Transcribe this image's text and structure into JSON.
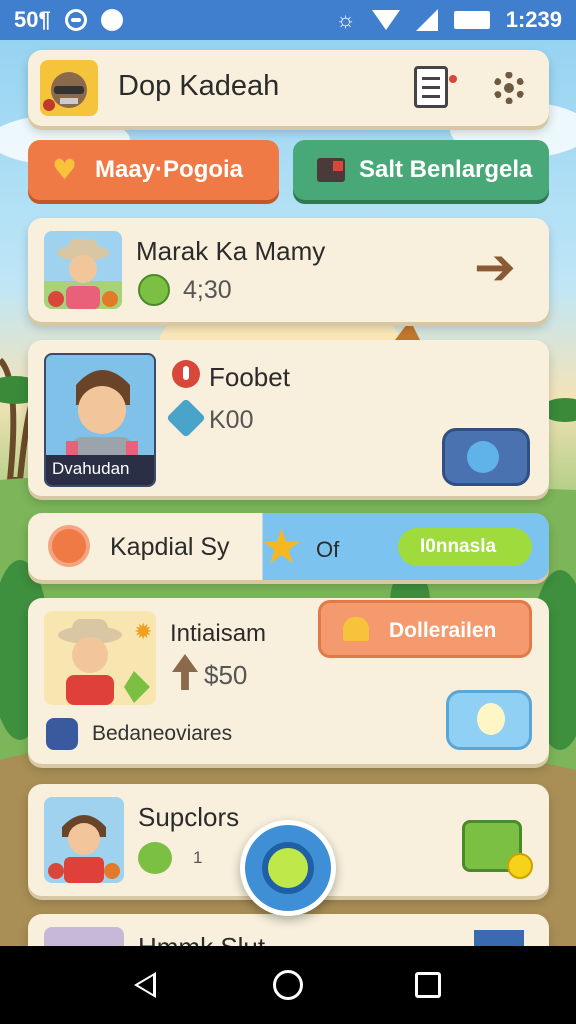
{
  "status_bar": {
    "left_text": "50¶",
    "time": "1:239"
  },
  "header": {
    "title": "Dop Kadeah",
    "notes_icon": "clipboard-icon",
    "settings_icon": "gear-icon"
  },
  "tabs": [
    {
      "label": "Maay·Pogoia",
      "icon": "heart-icon",
      "color": "#f07a45"
    },
    {
      "label": "Salt Benlargela",
      "icon": "flag-icon",
      "color": "#49a877"
    }
  ],
  "cards": {
    "marak": {
      "title": "Marak Ka Mamy",
      "value": "4;30"
    },
    "foobet": {
      "title": "Foobet",
      "value": "K00",
      "avatar_caption": "Dvahudan"
    },
    "kapdial": {
      "title": "Kapdial Sy",
      "middle": "Of",
      "badge": "I0nnasla"
    },
    "intiaisam": {
      "title": "Intiaisam",
      "value": "$50",
      "button": "Dollerailen",
      "footer": "Bedaneoviares"
    },
    "supclors": {
      "title": "Supclors",
      "value": "1"
    },
    "partial": {
      "title": "Hmmk Slut"
    }
  },
  "colors": {
    "status_bar": "#3f7fce",
    "card": "#f8f0dc",
    "orange": "#f07a45",
    "green": "#49a877",
    "lime": "#9fdb3c"
  }
}
